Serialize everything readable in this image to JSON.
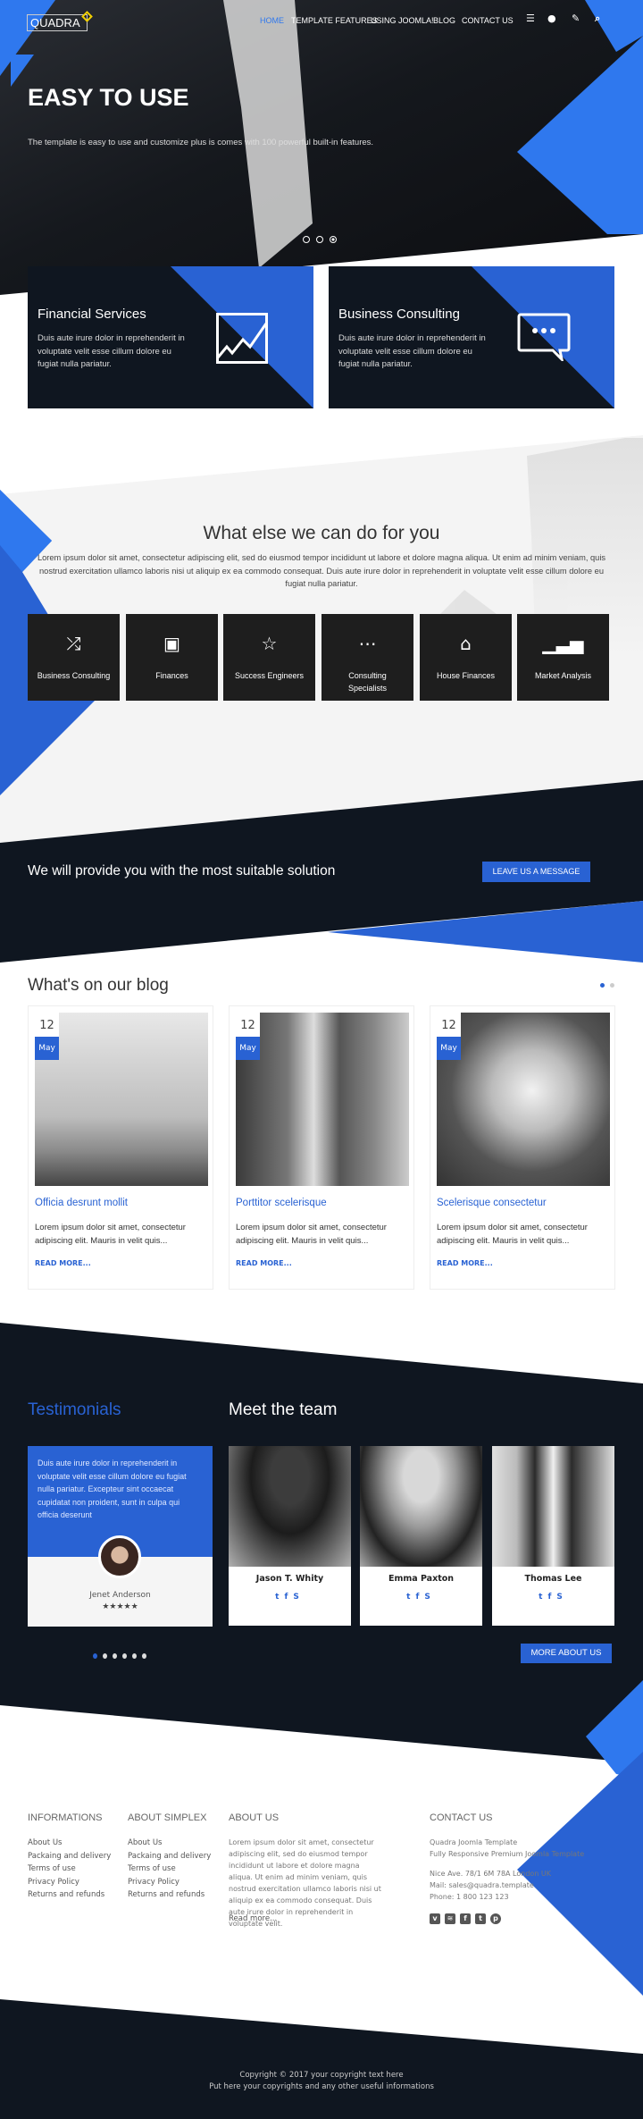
{
  "colors": {
    "dark": "#0f1620",
    "blue": "#2962d3",
    "bright_blue": "#2f78ee",
    "gray_bg": "#f4f4f4"
  },
  "header": {
    "logo": "QUADRA",
    "nav": [
      "HOME",
      "TEMPLATE FEATURES",
      "USING JOOMLA!",
      "BLOG",
      "CONTACT US"
    ],
    "active": "HOME",
    "icons": [
      "menu-icon",
      "user-icon",
      "pencil-icon",
      "search-icon"
    ]
  },
  "hero": {
    "title": "EASY TO USE",
    "subtitle": "The template is easy to use and customize plus is comes with 100 powerful built-in features.",
    "slides": 3,
    "active_slide": 3
  },
  "features": [
    {
      "title": "Financial Services",
      "text": "Duis aute irure dolor in reprehenderit in voluptate velit esse cillum dolore eu fugiat nulla pariatur.",
      "icon": "chart-icon"
    },
    {
      "title": "Business Consulting",
      "text": "Duis aute irure dolor in reprehenderit in voluptate velit esse cillum dolore eu fugiat nulla pariatur.",
      "icon": "chat-icon"
    }
  ],
  "services": {
    "title": "What else we can do for you",
    "text": "Lorem ipsum dolor sit amet, consectetur adipiscing elit, sed do eiusmod tempor incididunt ut labore et dolore magna aliqua. Ut enim ad minim veniam, quis nostrud exercitation ullamco laboris nisi ut aliquip ex ea commodo consequat. Duis aute irure dolor in reprehenderit in voluptate velit esse cillum dolore eu fugiat nulla pariatur.",
    "items": [
      {
        "label": "Business Consulting",
        "icon": "shuffle-icon"
      },
      {
        "label": "Finances",
        "icon": "money-icon"
      },
      {
        "label": "Success Engineers",
        "icon": "star-icon"
      },
      {
        "label": "Consulting Specialists",
        "icon": "chat-icon"
      },
      {
        "label": "House Finances",
        "icon": "house-icon"
      },
      {
        "label": "Market Analysis",
        "icon": "bar-chart-icon"
      }
    ]
  },
  "cta": {
    "text": "We will provide you with the most suitable solution",
    "button": "LEAVE US A MESSAGE"
  },
  "blog": {
    "title": "What's on our blog",
    "pages": 2,
    "active_page": 1,
    "posts": [
      {
        "day": "12",
        "month": "May",
        "title": "Officia desrunt mollit",
        "text": "Lorem ipsum dolor sit amet, consectetur adipiscing elit. Mauris in velit quis...",
        "more": "READ MORE..."
      },
      {
        "day": "12",
        "month": "May",
        "title": "Porttitor scelerisque",
        "text": "Lorem ipsum dolor sit amet, consectetur adipiscing elit. Mauris in velit quis...",
        "more": "READ MORE..."
      },
      {
        "day": "12",
        "month": "May",
        "title": "Scelerisque consectetur",
        "text": "Lorem ipsum dolor sit amet, consectetur adipiscing elit. Mauris in velit quis...",
        "more": "READ MORE..."
      }
    ]
  },
  "testimonials": {
    "title": "Testimonials",
    "text": "Duis aute irure dolor in reprehenderit in voluptate velit esse cillum dolore eu fugiat nulla pariatur. Excepteur sint occaecat cupidatat non proident, sunt in culpa qui officia deserunt",
    "name": "Jenet Anderson",
    "stars": "★★★★★",
    "rating": 5,
    "pages": 6,
    "active_page": 1
  },
  "team": {
    "title": "Meet the team",
    "members": [
      {
        "name": "Jason T. Whity"
      },
      {
        "name": "Emma Paxton"
      },
      {
        "name": "Thomas Lee"
      }
    ],
    "social": "𝕥 f S",
    "button": "MORE ABOUT US"
  },
  "footer": {
    "informations": {
      "title": "INFORMATIONS",
      "links": [
        "About Us",
        "Packaing and delivery",
        "Terms of use",
        "Privacy Policy",
        "Returns and refunds"
      ]
    },
    "about_simplex": {
      "title": "ABOUT SIMPLEX",
      "links": [
        "About Us",
        "Packaing and delivery",
        "Terms of use",
        "Privacy Policy",
        "Returns and refunds"
      ]
    },
    "about_us": {
      "title": "ABOUT US",
      "text": "Lorem ipsum dolor sit amet, consectetur adipiscing elit, sed do eiusmod tempor incididunt ut labore et dolore magna aliqua. Ut enim ad minim veniam, quis nostrud exercitation ullamco laboris nisi ut aliquip ex ea commodo consequat. Duis aute irure dolor in reprehenderit in voluptate velit.",
      "more": "Read more..."
    },
    "contact": {
      "title": "CONTACT US",
      "lines": [
        "Quadra Joomla Template",
        "Fully Responsive Premium Joomla Template"
      ],
      "address": "Nice Ave. 78/1 6M 78A London UK",
      "mail": "Mail: sales@quadra.template",
      "phone": "Phone: 1 800 123 123",
      "social": [
        "vimeo-icon",
        "rss-icon",
        "facebook-icon",
        "twitter-icon",
        "pinterest-icon"
      ]
    },
    "copyright": "Copyright © 2017 your copyright text here",
    "copyright2": "Put here your copyrights and any other useful informations"
  }
}
